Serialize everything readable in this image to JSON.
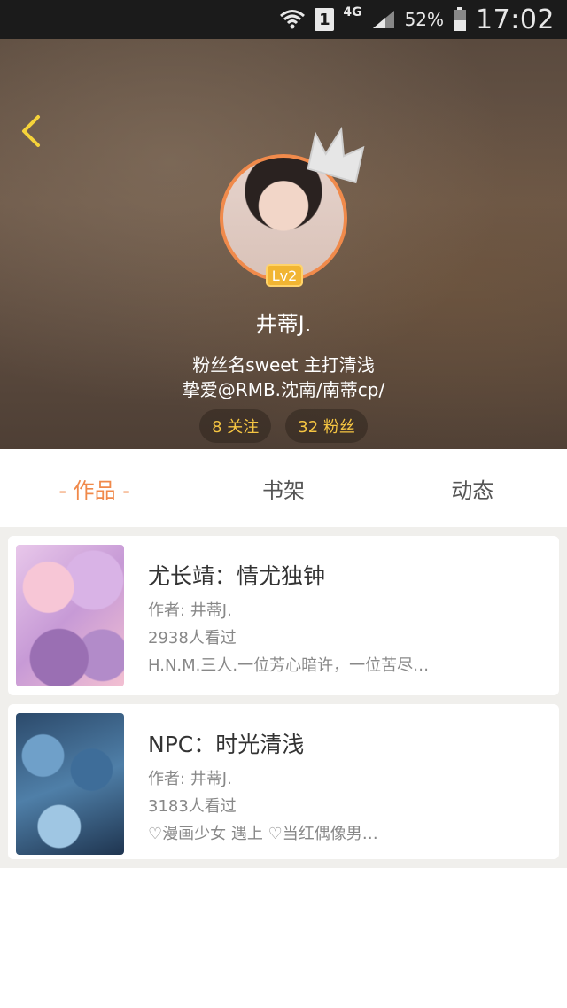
{
  "status_bar": {
    "network": "4G",
    "sim_slot": "1",
    "battery": "52%",
    "time": "17:02"
  },
  "profile": {
    "level": "Lv2",
    "username": "井蒂J.",
    "bio_line1": "粉丝名sweet  主打清浅",
    "bio_line2": "挚爱@RMB.沈南/南蒂cp/",
    "following": "8 关注",
    "followers": "32 粉丝"
  },
  "tabs": [
    {
      "label": "- 作品 -",
      "active": true
    },
    {
      "label": "书架",
      "active": false
    },
    {
      "label": "动态",
      "active": false
    }
  ],
  "works": [
    {
      "title": "尤长靖：情尤独钟",
      "author": "作者: 井蒂J.",
      "views": "2938人看过",
      "desc": "H.N.M.三人.一位芳心暗许，一位苦尽…"
    },
    {
      "title": "NPC：时光清浅",
      "author": "作者: 井蒂J.",
      "views": "3183人看过",
      "desc": "♡漫画少女 遇上 ♡当红偶像男…"
    }
  ],
  "colors": {
    "accent": "#f0894a",
    "badge": "#f1b533",
    "pill_text": "#f5c542"
  }
}
